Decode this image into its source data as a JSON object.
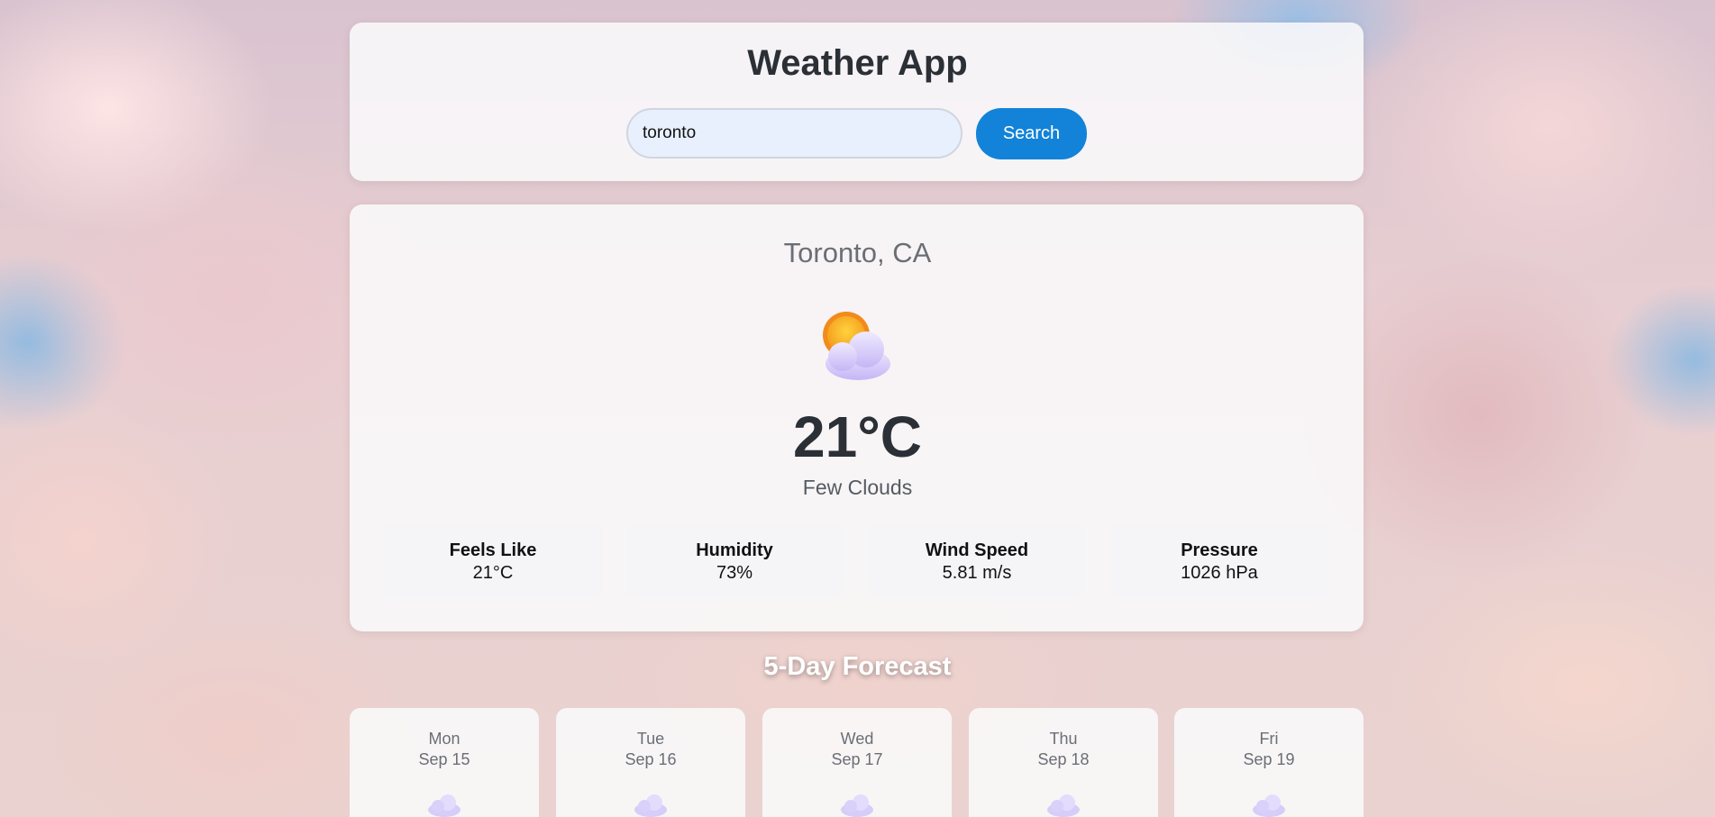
{
  "header": {
    "title": "Weather App",
    "search_value": "toronto",
    "search_button": "Search"
  },
  "current": {
    "city": "Toronto, CA",
    "icon": "sun-behind-cloud-icon",
    "temperature": "21°C",
    "description": "Few Clouds",
    "stats": [
      {
        "label": "Feels Like",
        "value": "21°C"
      },
      {
        "label": "Humidity",
        "value": "73%"
      },
      {
        "label": "Wind Speed",
        "value": "5.81 m/s"
      },
      {
        "label": "Pressure",
        "value": "1026 hPa"
      }
    ]
  },
  "forecast": {
    "title": "5-Day Forecast",
    "days": [
      {
        "day": "Mon",
        "date": "Sep 15",
        "icon": "cloud-icon"
      },
      {
        "day": "Tue",
        "date": "Sep 16",
        "icon": "cloud-icon"
      },
      {
        "day": "Wed",
        "date": "Sep 17",
        "icon": "cloud-icon"
      },
      {
        "day": "Thu",
        "date": "Sep 18",
        "icon": "cloud-icon"
      },
      {
        "day": "Fri",
        "date": "Sep 19",
        "icon": "cloud-icon"
      }
    ]
  },
  "colors": {
    "accent": "#1283d8",
    "title_text": "#2b3036",
    "muted_text": "#6a6f75"
  }
}
